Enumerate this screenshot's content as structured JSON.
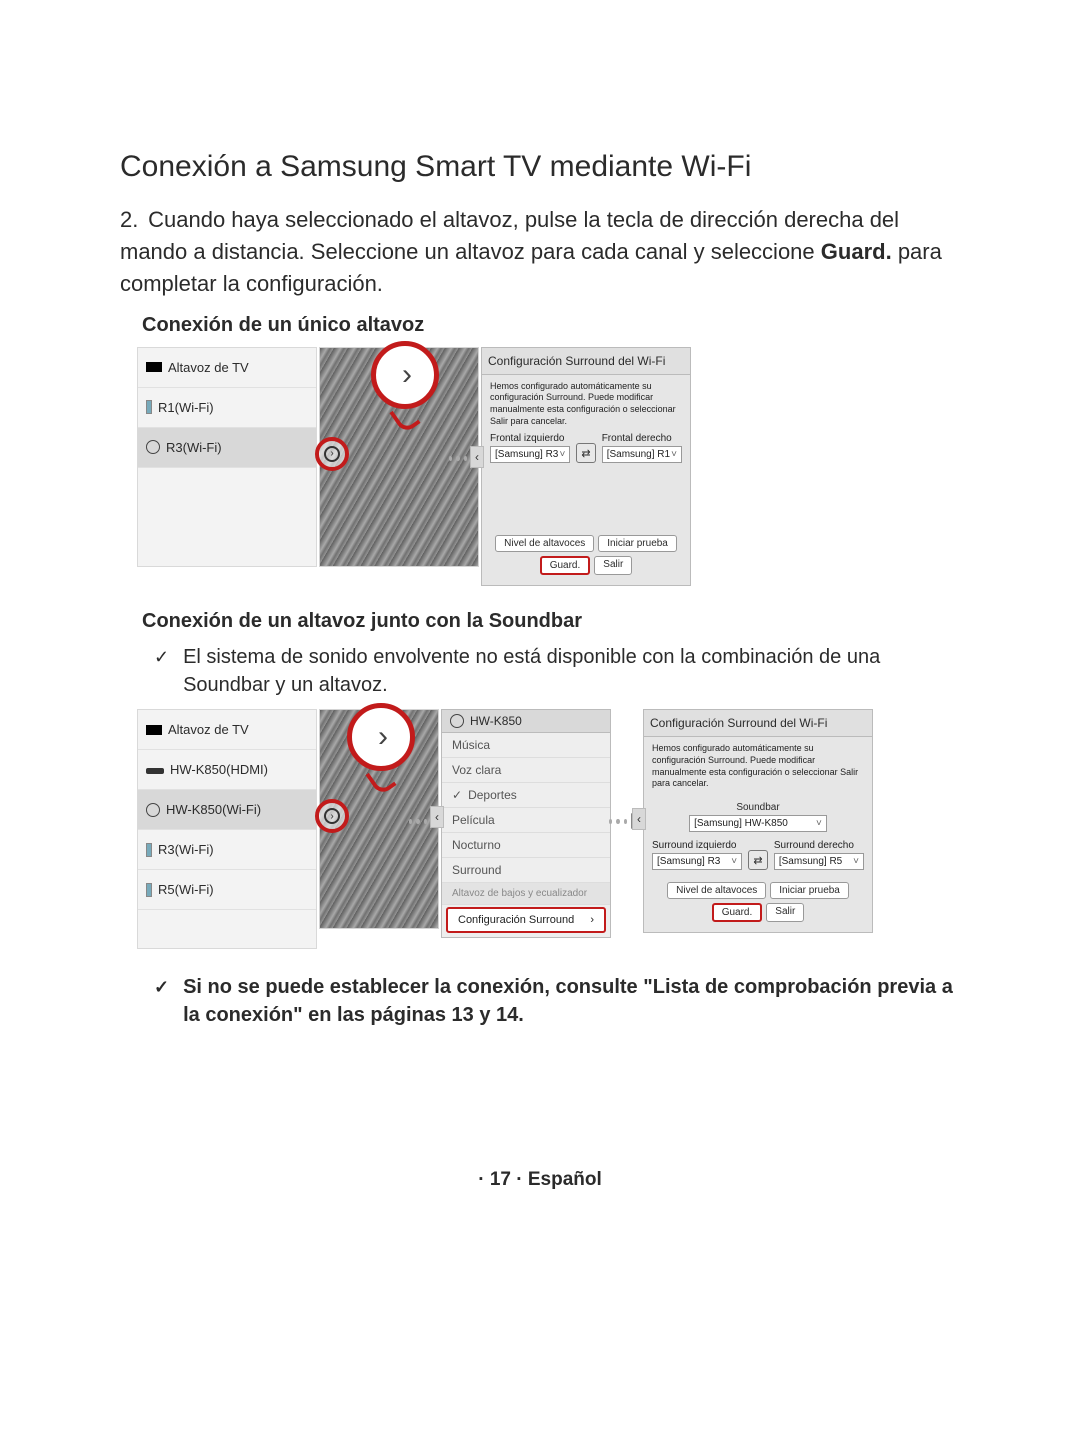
{
  "title": "Conexión a Samsung Smart TV mediante Wi-Fi",
  "step": {
    "num": "2.",
    "line1": "Cuando haya seleccionado el altavoz, pulse la tecla de dirección derecha del mando a distancia. Seleccione un altavoz para cada canal y seleccione ",
    "bold": "Guard.",
    "line2": " para completar la configuración."
  },
  "section1": {
    "heading": "Conexión de un único altavoz",
    "speakers": {
      "tv": "Altavoz de TV",
      "r1": "R1(Wi-Fi)",
      "r3": "R3(Wi-Fi)"
    },
    "panel": {
      "title": "Configuración Surround del Wi-Fi",
      "desc": "Hemos configurado automáticamente su configuración Surround. Puede modificar manualmente esta configuración o seleccionar Salir para cancelar.",
      "left_label": "Frontal izquierdo",
      "right_label": "Frontal derecho",
      "left_val": "[Samsung] R3",
      "right_val": "[Samsung] R1",
      "btn_level": "Nivel de altavoces",
      "btn_test": "Iniciar prueba",
      "btn_guard": "Guard.",
      "btn_exit": "Salir"
    }
  },
  "section2": {
    "heading": "Conexión de un altavoz junto con la Soundbar",
    "note": "El sistema de sonido envolvente no está disponible con la combinación de una Soundbar y un altavoz.",
    "speakers": {
      "tv": "Altavoz de TV",
      "hdmi": "HW-K850(HDMI)",
      "wifi": "HW-K850(Wi-Fi)",
      "r3": "R3(Wi-Fi)",
      "r5": "R5(Wi-Fi)"
    },
    "soundmenu": {
      "name": "HW-K850",
      "items": [
        "Música",
        "Voz clara",
        "Deportes",
        "Película",
        "Nocturno",
        "Surround"
      ],
      "selected_index": 2,
      "section_label": "Altavoz de bajos y ecualizador",
      "surround_cfg": "Configuración Surround"
    },
    "panel": {
      "title": "Configuración Surround del Wi-Fi",
      "desc": "Hemos configurado automáticamente su configuración Surround. Puede modificar manualmente esta configuración o seleccionar Salir para cancelar.",
      "sb_label": "Soundbar",
      "sb_val": "[Samsung] HW-K850",
      "left_label": "Surround izquierdo",
      "right_label": "Surround derecho",
      "left_val": "[Samsung] R3",
      "right_val": "[Samsung] R5",
      "btn_level": "Nivel de altavoces",
      "btn_test": "Iniciar prueba",
      "btn_guard": "Guard.",
      "btn_exit": "Salir"
    }
  },
  "final_note": "Si no se puede establecer la conexión, consulte \"Lista de comprobación previa a la conexión\" en las páginas 13 y 14.",
  "check_glyph": "✓",
  "chevron": "›",
  "caret": "˅",
  "swap": "⇄",
  "lt": "‹",
  "footer": "· 17 · Español"
}
